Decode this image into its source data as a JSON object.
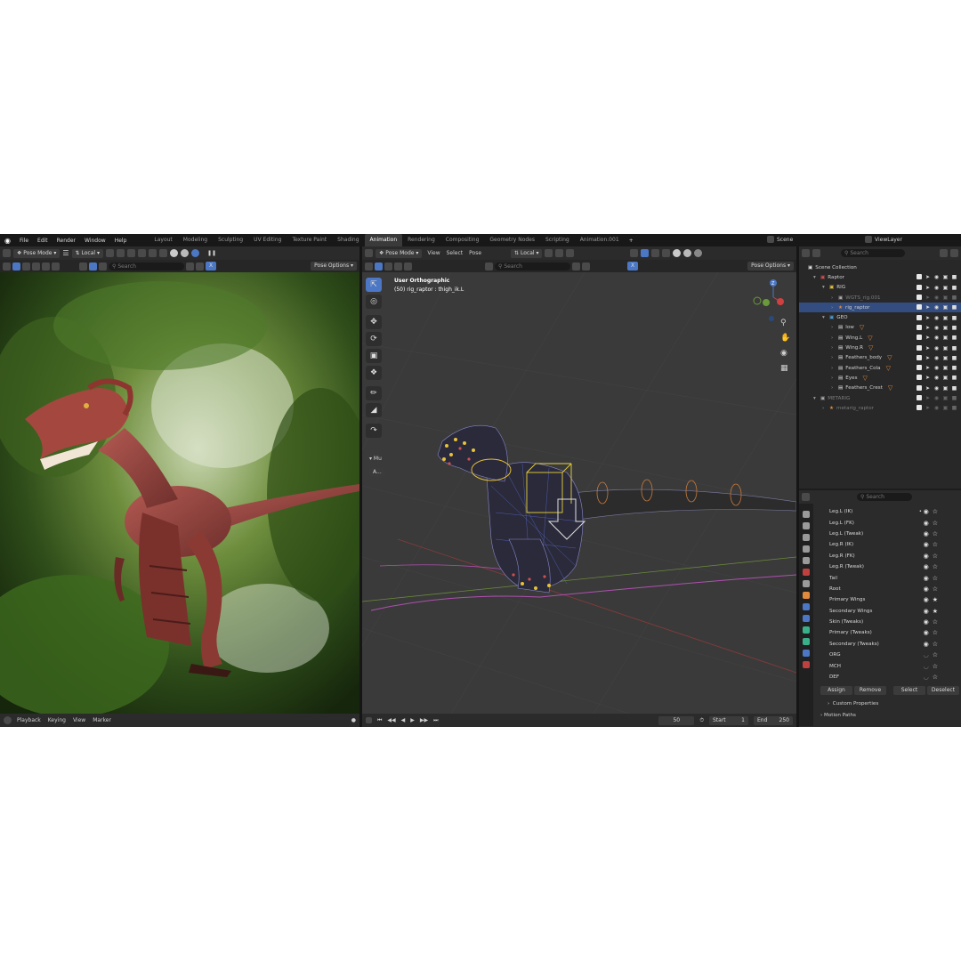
{
  "menu": [
    "File",
    "Edit",
    "Render",
    "Window",
    "Help"
  ],
  "workspaces": [
    {
      "label": "Layout",
      "active": false
    },
    {
      "label": "Modeling",
      "active": false
    },
    {
      "label": "Sculpting",
      "active": false
    },
    {
      "label": "UV Editing",
      "active": false
    },
    {
      "label": "Texture Paint",
      "active": false
    },
    {
      "label": "Shading",
      "active": false
    },
    {
      "label": "Animation",
      "active": true
    },
    {
      "label": "Rendering",
      "active": false
    },
    {
      "label": "Compositing",
      "active": false
    },
    {
      "label": "Geometry Nodes",
      "active": false
    },
    {
      "label": "Scripting",
      "active": false
    },
    {
      "label": "Animation.001",
      "active": false
    }
  ],
  "top_right": {
    "scene": "Scene",
    "view_layer": "ViewLayer"
  },
  "left_viewport": {
    "mode": "Pose Mode",
    "orientation": "Local",
    "search_placeholder": "Search",
    "pose_options": "Pose Options",
    "axis_x": "X"
  },
  "center_viewport": {
    "mode": "Pose Mode",
    "menus": [
      "View",
      "Select",
      "Pose"
    ],
    "orientation": "Local",
    "search_placeholder": "Search",
    "pose_options": "Pose Options",
    "axis_x": "X",
    "overlay_title": "User Orthographic",
    "overlay_subtitle": "(50) rig_raptor : thigh_ik.L",
    "panel_label": "Mu",
    "panel_button": "A..."
  },
  "outliner": {
    "search_placeholder": "Search",
    "root": "Scene Collection",
    "items": [
      {
        "label": "Raptor",
        "depth": 1,
        "kind": "collection",
        "selected": false,
        "dim": false
      },
      {
        "label": "RIG",
        "depth": 2,
        "kind": "collection",
        "selected": false,
        "dim": false
      },
      {
        "label": "WGTS_rig.001",
        "depth": 3,
        "kind": "collection",
        "selected": false,
        "dim": true
      },
      {
        "label": "rig_raptor",
        "depth": 3,
        "kind": "armature",
        "selected": true,
        "dim": false
      },
      {
        "label": "GEO",
        "depth": 2,
        "kind": "collection",
        "selected": false,
        "dim": false
      },
      {
        "label": "low",
        "depth": 3,
        "kind": "mesh",
        "selected": false,
        "dim": false
      },
      {
        "label": "Wing.L",
        "depth": 3,
        "kind": "mesh",
        "selected": false,
        "dim": false
      },
      {
        "label": "Wing.R",
        "depth": 3,
        "kind": "mesh",
        "selected": false,
        "dim": false
      },
      {
        "label": "Feathers_body",
        "depth": 3,
        "kind": "mesh",
        "selected": false,
        "dim": false
      },
      {
        "label": "Feathers_Cola",
        "depth": 3,
        "kind": "mesh",
        "selected": false,
        "dim": false
      },
      {
        "label": "Eyes",
        "depth": 3,
        "kind": "mesh",
        "selected": false,
        "dim": false
      },
      {
        "label": "Feathers_Crest",
        "depth": 3,
        "kind": "mesh",
        "selected": false,
        "dim": false
      },
      {
        "label": "METARIG",
        "depth": 1,
        "kind": "collection",
        "selected": false,
        "dim": true
      },
      {
        "label": "metarig_raptor",
        "depth": 2,
        "kind": "armature",
        "selected": false,
        "dim": true
      }
    ]
  },
  "properties": {
    "search_placeholder": "Search",
    "bone_collections": [
      {
        "label": "Leg.L (IK)",
        "visible": true,
        "solo": false
      },
      {
        "label": "Leg.L (FK)",
        "visible": true,
        "solo": false
      },
      {
        "label": "Leg.L (Tweak)",
        "visible": true,
        "solo": false
      },
      {
        "label": "Leg.R (IK)",
        "visible": true,
        "solo": false
      },
      {
        "label": "Leg.R (FK)",
        "visible": true,
        "solo": false
      },
      {
        "label": "Leg.R (Tweak)",
        "visible": true,
        "solo": false
      },
      {
        "label": "Tail",
        "visible": true,
        "solo": false
      },
      {
        "label": "Root",
        "visible": true,
        "solo": false
      },
      {
        "label": "Primary Wings",
        "visible": true,
        "solo": true
      },
      {
        "label": "Secondary Wings",
        "visible": true,
        "solo": true
      },
      {
        "label": "Skin (Tweaks)",
        "visible": true,
        "solo": false
      },
      {
        "label": "Primary (Tweaks)",
        "visible": true,
        "solo": false
      },
      {
        "label": "Secondary (Tweaks)",
        "visible": true,
        "solo": false
      },
      {
        "label": "ORG",
        "visible": false,
        "solo": false
      },
      {
        "label": "MCH",
        "visible": false,
        "solo": false
      },
      {
        "label": "DEF",
        "visible": false,
        "solo": false
      }
    ],
    "buttons": {
      "assign": "Assign",
      "remove": "Remove",
      "select": "Select",
      "deselect": "Deselect"
    },
    "custom_properties": "Custom Properties",
    "motion_paths": "Motion Paths"
  },
  "timeline": {
    "menus": [
      "Playback",
      "Keying",
      "View",
      "Marker"
    ],
    "current_frame": "50",
    "start_label": "Start",
    "start_value": "1",
    "end_label": "End",
    "end_value": "250"
  },
  "colors": {
    "accent": "#4b77c4",
    "selection": "#334d80",
    "mesh_icon": "#e08a3c",
    "bg": "#1d1d1d"
  }
}
